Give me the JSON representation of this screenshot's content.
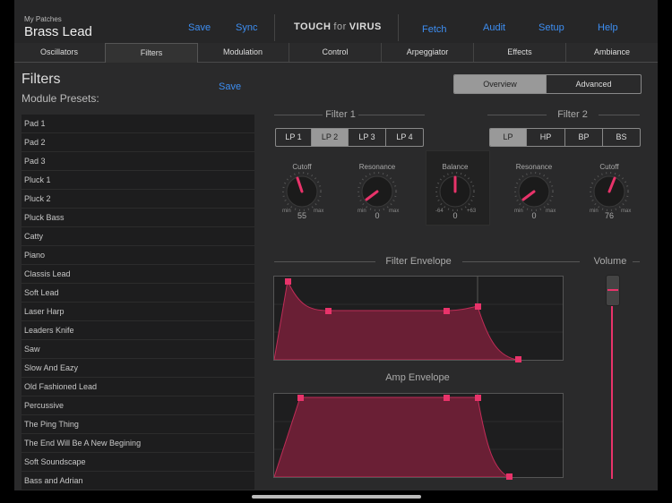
{
  "header": {
    "patch_caption": "My Patches",
    "patch_name": "Brass Lead",
    "save_label": "Save",
    "sync_label": "Sync",
    "logo": {
      "touch": "TOUCH",
      "for": "for",
      "virus": "VIRUS"
    },
    "fetch_label": "Fetch",
    "audit_label": "Audit",
    "setup_label": "Setup",
    "help_label": "Help",
    "link_color": "#3d8ef2"
  },
  "tabs": [
    {
      "label": "Oscillators"
    },
    {
      "label": "Filters"
    },
    {
      "label": "Modulation"
    },
    {
      "label": "Control"
    },
    {
      "label": "Arpeggiator"
    },
    {
      "label": "Effects"
    },
    {
      "label": "Ambiance"
    }
  ],
  "active_tab": "Filters",
  "left": {
    "title": "Filters",
    "subtitle": "Module Presets:",
    "save_label": "Save",
    "presets": [
      "Pad 1",
      "Pad 2",
      "Pad 3",
      "Pluck 1",
      "Pluck 2",
      "Pluck Bass",
      "Catty",
      "Piano",
      "Classis Lead",
      "Soft Lead",
      "Laser Harp",
      "Leaders Knife",
      "Saw",
      "Slow And Eazy",
      "Old Fashioned Lead",
      "Percussive",
      "The Ping Thing",
      "The End Will Be A New Begining",
      "Soft Soundscape",
      "Bass and Adrian"
    ]
  },
  "view_toggle": {
    "overview": "Overview",
    "advanced": "Advanced",
    "selected": "Overview"
  },
  "filter1": {
    "title": "Filter 1",
    "modes": [
      "LP 1",
      "LP 2",
      "LP 3",
      "LP 4"
    ],
    "selected": "LP 2",
    "cutoff": {
      "label": "Cutoff",
      "min": "min",
      "max": "max",
      "value": "55"
    },
    "resonance": {
      "label": "Resonance",
      "min": "min",
      "max": "max",
      "value": "0"
    }
  },
  "balance": {
    "label": "Balance",
    "min": "-64",
    "max": "+63",
    "value": "0"
  },
  "filter2": {
    "title": "Filter 2",
    "modes": [
      "LP",
      "HP",
      "BP",
      "BS"
    ],
    "selected": "LP",
    "resonance": {
      "label": "Resonance",
      "min": "min",
      "max": "max",
      "value": "0"
    },
    "cutoff": {
      "label": "Cutoff",
      "min": "min",
      "max": "max",
      "value": "76"
    }
  },
  "filter_envelope": {
    "title": "Filter Envelope"
  },
  "volume": {
    "title": "Volume"
  },
  "amp_envelope": {
    "title": "Amp Envelope"
  },
  "colors": {
    "accent": "#e8336a",
    "envelope_fill": "#6a1f35"
  }
}
